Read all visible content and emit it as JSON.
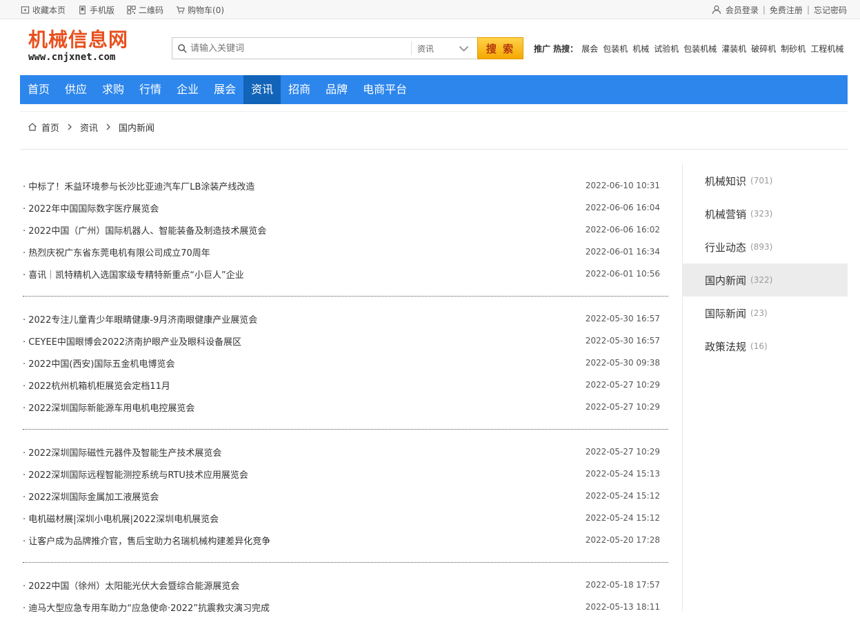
{
  "topbar": {
    "bookmark": "收藏本页",
    "mobile": "手机版",
    "qrcode": "二维码",
    "cart": "购物车(0)",
    "login": "会员登录",
    "register": "免费注册",
    "forgot": "忘记密码"
  },
  "logo": {
    "name": "机械信息网",
    "url": "www.cnjxnet.com"
  },
  "search": {
    "placeholder": "请输入关键词",
    "category": "资讯",
    "button": "搜 索"
  },
  "hot": {
    "label": "推广 热搜：",
    "items": [
      "展会",
      "包装机",
      "机械",
      "试验机",
      "包装机械",
      "灌装机",
      "破碎机",
      "制砂机",
      "工程机械"
    ]
  },
  "nav": {
    "items": [
      "首页",
      "供应",
      "求购",
      "行情",
      "企业",
      "展会",
      "资讯",
      "招商",
      "品牌",
      "电商平台"
    ],
    "active": "资讯"
  },
  "breadcrumb": [
    "首页",
    "资讯",
    "国内新闻"
  ],
  "news_groups": [
    [
      {
        "title": "· 中标了！禾益环境参与长沙比亚迪汽车厂LB涂装产线改造",
        "date": "2022-06-10 10:31"
      },
      {
        "title": "· 2022年中国国际数字医疗展览会",
        "date": "2022-06-06 16:04"
      },
      {
        "title": "· 2022中国（广州）国际机器人、智能装备及制造技术展览会",
        "date": "2022-06-06 16:02"
      },
      {
        "title": "· 热烈庆祝广东省东莞电机有限公司成立70周年",
        "date": "2022-06-01 16:34"
      },
      {
        "title": "· 喜讯｜凯特精机入选国家级专精特新重点“小巨人”企业",
        "date": "2022-06-01 10:56"
      }
    ],
    [
      {
        "title": "· 2022专注儿童青少年眼睛健康-9月济南眼健康产业展览会",
        "date": "2022-05-30 16:57"
      },
      {
        "title": "· CEYEE中国眼博会2022济南护眼产业及眼科设备展区",
        "date": "2022-05-30 16:57"
      },
      {
        "title": "· 2022中国(西安)国际五金机电博览会",
        "date": "2022-05-30 09:38"
      },
      {
        "title": "· 2022杭州机箱机柜展览会定档11月",
        "date": "2022-05-27 10:29"
      },
      {
        "title": "· 2022深圳国际新能源车用电机电控展览会",
        "date": "2022-05-27 10:29"
      }
    ],
    [
      {
        "title": "· 2022深圳国际磁性元器件及智能生产技术展览会",
        "date": "2022-05-27 10:29"
      },
      {
        "title": "· 2022深圳国际远程智能测控系统与RTU技术应用展览会",
        "date": "2022-05-24 15:13"
      },
      {
        "title": "· 2022深圳国际金属加工液展览会",
        "date": "2022-05-24 15:12"
      },
      {
        "title": "· 电机磁材展|深圳小电机展|2022深圳电机展览会",
        "date": "2022-05-24 15:12"
      },
      {
        "title": "· 让客户成为品牌推介官，售后宝助力名瑞机械构建差异化竞争",
        "date": "2022-05-20 17:28"
      }
    ],
    [
      {
        "title": "· 2022中国（徐州）太阳能光伏大会暨综合能源展览会",
        "date": "2022-05-18 17:57"
      },
      {
        "title": "· 迪马大型应急专用车助力“应急使命·2022”抗震救灾演习完成",
        "date": "2022-05-13 18:11"
      }
    ]
  ],
  "sidebar": {
    "items": [
      {
        "label": "机械知识",
        "count": "(701)"
      },
      {
        "label": "机械营销",
        "count": "(323)"
      },
      {
        "label": "行业动态",
        "count": "(893)"
      },
      {
        "label": "国内新闻",
        "count": "(322)"
      },
      {
        "label": "国际新闻",
        "count": "(23)"
      },
      {
        "label": "政策法规",
        "count": "(16)"
      }
    ],
    "active": "国内新闻"
  },
  "colors": {
    "nav_bg": "#2d86ec",
    "nav_active": "#1264b8",
    "logo": "#e8501e",
    "search_btn": "#f5a800"
  }
}
